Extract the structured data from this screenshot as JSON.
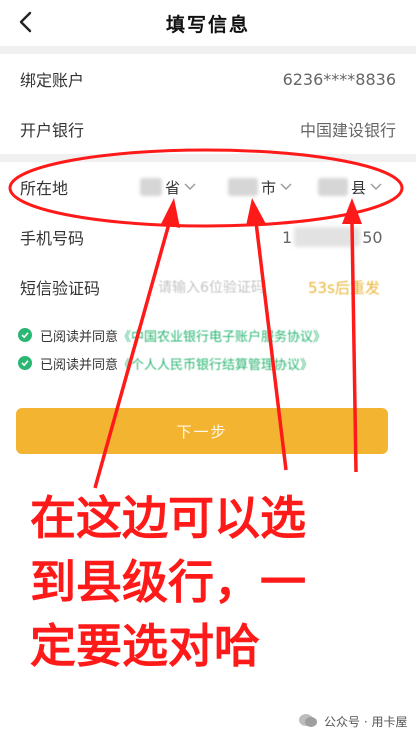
{
  "header": {
    "title": "填写信息",
    "back_icon": "chevron-left-icon"
  },
  "form": {
    "bound_account": {
      "label": "绑定账户",
      "value": "6236****8836"
    },
    "bank": {
      "label": "开户银行",
      "value": "中国建设银行"
    },
    "location": {
      "label": "所在地",
      "province_suffix": "省",
      "city_suffix": "市",
      "county_suffix": "县"
    },
    "phone": {
      "label": "手机号码",
      "prefix": "1",
      "suffix": "50"
    },
    "sms": {
      "label": "短信验证码",
      "placeholder": "请输入6位验证码",
      "resend": "53s后重发"
    }
  },
  "agreements": [
    {
      "prefix": "已阅读并同意",
      "link": "《中国农业银行电子账户服务协议》"
    },
    {
      "prefix": "已阅读并同意",
      "link": "《个人人民币银行结算管理协议》"
    }
  ],
  "next_button": {
    "label": "下一步"
  },
  "annotation": {
    "lines": [
      "在这边可以选",
      "到县级行，一",
      "定要选对哈"
    ]
  },
  "watermark": {
    "text": "公众号 · 用卡屋"
  },
  "colors": {
    "accent": "#f3b531",
    "agree_green": "#2bb673",
    "annotation_red": "#ff1a1a",
    "resend_gold": "#e9b63a"
  }
}
